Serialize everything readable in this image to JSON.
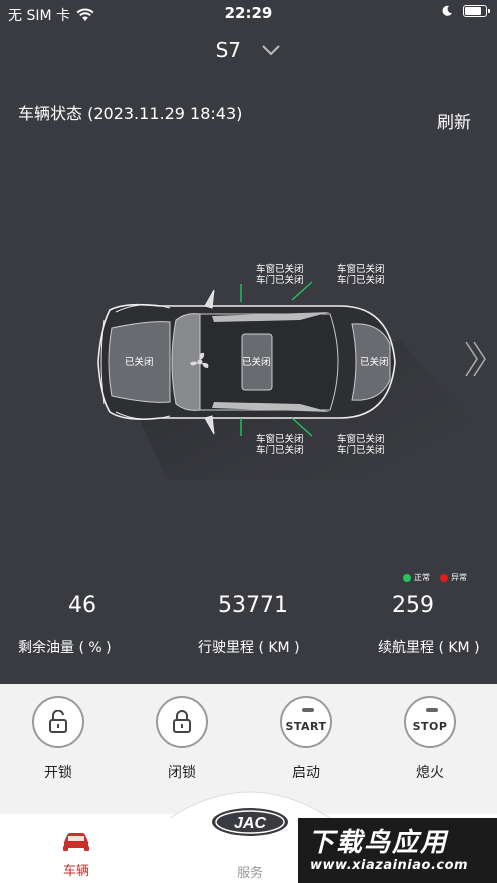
{
  "statusbar": {
    "carrier": "无 SIM 卡",
    "time": "22:29",
    "battery_level": 0.85
  },
  "header": {
    "model": "S7"
  },
  "vehicle_status": {
    "title": "车辆状态 (2023.11.29 18:43)",
    "refresh": "刷新"
  },
  "car": {
    "front_hood": "已关闭",
    "sunroof": "已关闭",
    "trunk": "已关闭",
    "labels": {
      "top_left": {
        "window": "车窗已关闭",
        "door": "车门已关闭"
      },
      "top_right": {
        "window": "车窗已关闭",
        "door": "车门已关闭"
      },
      "bottom_left": {
        "window": "车窗已关闭",
        "door": "车门已关闭"
      },
      "bottom_right": {
        "window": "车窗已关闭",
        "door": "车门已关闭"
      }
    }
  },
  "legend": {
    "normal": "正常",
    "abnormal": "异常",
    "normal_color": "#22c55e",
    "abnormal_color": "#e11d1d"
  },
  "stats": [
    {
      "value": "46",
      "label": "剩余油量 ( % )"
    },
    {
      "value": "53771",
      "label": "行驶里程 ( KM )"
    },
    {
      "value": "259",
      "label": "续航里程 ( KM )"
    }
  ],
  "controls": [
    {
      "label": "开锁"
    },
    {
      "label": "闭锁"
    },
    {
      "label": "启动",
      "word": "START"
    },
    {
      "label": "熄火",
      "word": "STOP"
    }
  ],
  "tabs": {
    "car": "车辆",
    "service": "服务"
  },
  "logo": {
    "text": "JAC"
  },
  "watermark": {
    "big": "下载鸟应用",
    "small": "www.xiazainiao.com"
  },
  "colors": {
    "background": "#3a3b40",
    "accent": "#c8312a"
  }
}
